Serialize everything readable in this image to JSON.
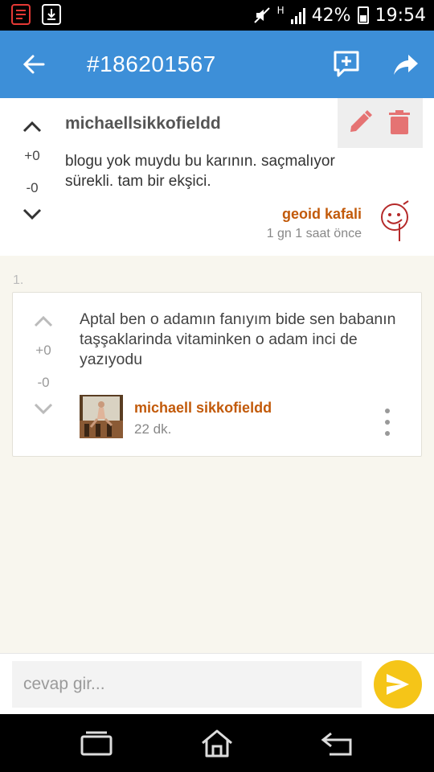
{
  "status_bar": {
    "battery": "42%",
    "time": "19:54",
    "network": "H"
  },
  "app_bar": {
    "title": "#186201567"
  },
  "entry": {
    "author": "michaellsikkofieldd",
    "upvotes": "+0",
    "downvotes": "-0",
    "text": "blogu yok muydu bu karının. saçmalıyor sürekli. tam bir ekşici.",
    "poster": "geoid kafali",
    "time": "1 gn 1 saat  önce"
  },
  "replies": {
    "index_label": "1.",
    "items": [
      {
        "upvotes": "+0",
        "downvotes": "-0",
        "text": "Aptal ben o adamın fanıyım bide sen babanın taşşaklarinda vitaminken o adam inci de yazıyodu",
        "author": "michaell sikkofieldd",
        "time": "22 dk."
      }
    ]
  },
  "reply_input": {
    "placeholder": "cevap gir...",
    "value": ""
  },
  "colors": {
    "app_bar": "#3d8fd8",
    "accent_orange": "#c25a0a",
    "send_button": "#f5c518",
    "delete_red": "#e57373"
  }
}
